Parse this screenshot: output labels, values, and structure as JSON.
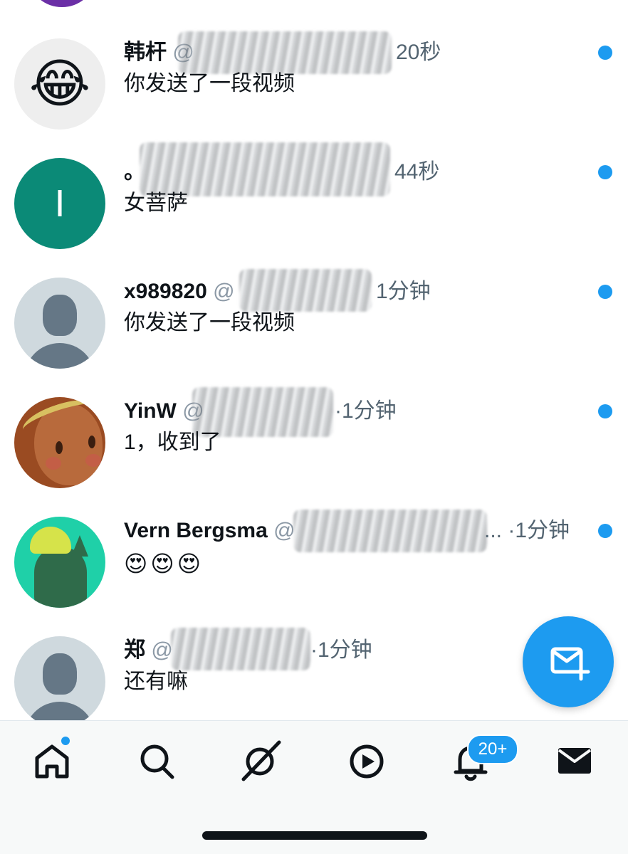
{
  "conversations": [
    {
      "name": "韩杆",
      "handle": "@",
      "time": "20秒",
      "message": "你发送了一段视频",
      "avatar_emoji": "😂",
      "unread": true
    },
    {
      "name": "。",
      "handle": "",
      "time": "44秒",
      "message": "女菩萨",
      "avatar_letter": "I",
      "unread": true
    },
    {
      "name": "x989820",
      "handle": "@",
      "time": "1分钟",
      "message": "你发送了一段视频",
      "unread": true
    },
    {
      "name": "YinW",
      "handle": "@",
      "time": "·1分钟",
      "message": "1，收到了",
      "unread": true
    },
    {
      "name": "Vern Bergsma",
      "handle": "@",
      "time": "... ·1分钟",
      "message": "😍😍😍",
      "unread": true
    },
    {
      "name": "郑",
      "handle": "@",
      "time": "·1分钟",
      "message": "还有嘛",
      "unread": false
    }
  ],
  "bottom_nav": {
    "items": [
      "home-icon",
      "search-icon",
      "grok-icon",
      "video-icon",
      "notifications-icon",
      "messages-icon"
    ],
    "notification_badge": "20+"
  },
  "fab": {
    "icon": "new-message-icon"
  },
  "colors": {
    "accent": "#1d9bf0",
    "text": "#0f1419",
    "muted": "#536471"
  }
}
